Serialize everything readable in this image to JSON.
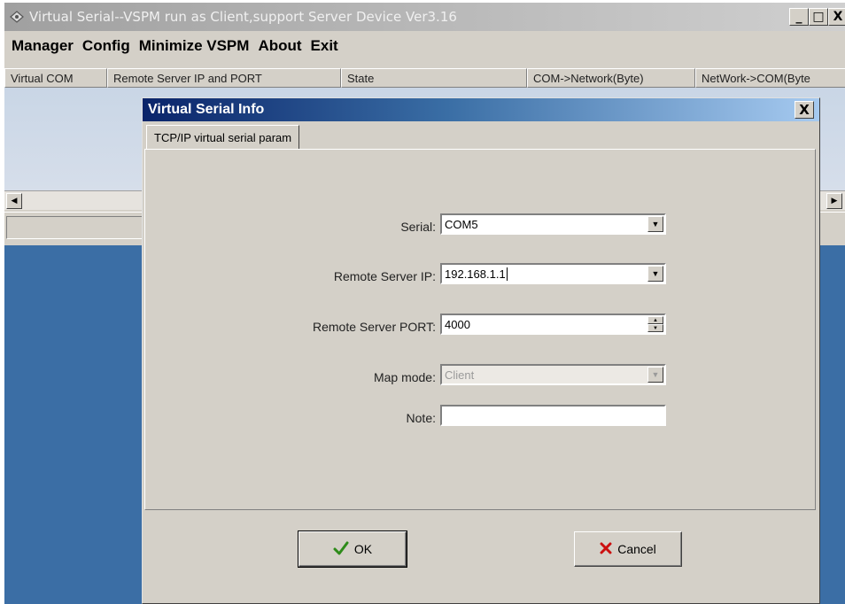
{
  "window": {
    "title": "Virtual Serial--VSPM run as Client,support Server Device  Ver3.16",
    "minimize": "_",
    "maximize": "□",
    "close": "X"
  },
  "menu": [
    "Manager",
    "Config",
    "Minimize VSPM",
    "About",
    "Exit"
  ],
  "list": {
    "columns": [
      "Virtual COM",
      "Remote Server IP and PORT",
      "State",
      "COM->Network(Byte)",
      "NetWork->COM(Byte"
    ]
  },
  "dialog": {
    "title": "Virtual Serial Info",
    "close": "X",
    "tab": "TCP/IP virtual serial param",
    "serial_label": "Serial:",
    "serial_value": "COM5",
    "ip_label": "Remote Server IP:",
    "ip_value": "192.168.1.1",
    "port_label": "Remote Server PORT:",
    "port_value": "4000",
    "mode_label": "Map mode:",
    "mode_value": "Client",
    "note_label": "Note:",
    "note_value": "",
    "ok_label": "OK",
    "cancel_label": "Cancel"
  },
  "colors": {
    "dialog_title_start": "#0a246a",
    "dialog_title_end": "#a6caf0",
    "desktop": "#3b6ea5",
    "ok_check": "#2e8b1a",
    "cancel_x": "#cc1010"
  }
}
